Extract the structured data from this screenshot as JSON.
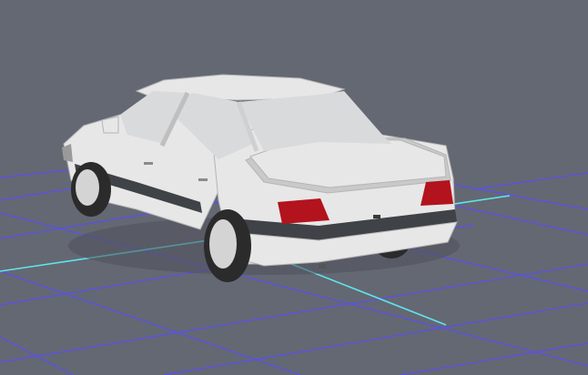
{
  "viewport": {
    "background": "#646873",
    "grid_color": "#5b4ff0",
    "axis_x_color": "#5fe6ec",
    "axis_z_color": "#5fe6ec"
  },
  "model": {
    "body_color": "#e7e7e7",
    "body_shadow": "#c9c9c9",
    "trim_color": "#3f4246",
    "glass_color": "#d9dadc",
    "taillight_color": "#b3131c",
    "tire_color": "#2b2b2b",
    "wheel_color": "#d4d4d4"
  }
}
